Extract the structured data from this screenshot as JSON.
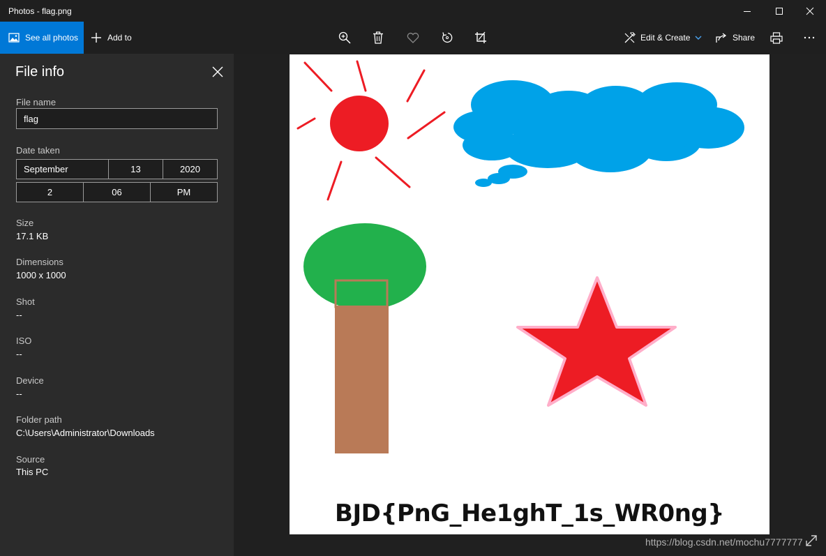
{
  "window": {
    "title": "Photos - flag.png"
  },
  "toolbar": {
    "see_all": "See all photos",
    "add_to": "Add to",
    "edit_create": "Edit & Create",
    "share": "Share"
  },
  "file_info": {
    "title": "File info",
    "file_name_label": "File name",
    "file_name": "flag",
    "date_taken_label": "Date taken",
    "month": "September",
    "day": "13",
    "year": "2020",
    "hour": "2",
    "minute": "06",
    "ampm": "PM",
    "size_label": "Size",
    "size": "17.1 KB",
    "dimensions_label": "Dimensions",
    "dimensions": "1000 x 1000",
    "shot_label": "Shot",
    "shot": "--",
    "iso_label": "ISO",
    "iso": "--",
    "device_label": "Device",
    "device": "--",
    "folder_label": "Folder path",
    "folder": "C:\\Users\\Administrator\\Downloads",
    "source_label": "Source",
    "source": "This PC"
  },
  "image": {
    "flag_text": "BJD{PnG_He1ghT_1s_WR0ng}",
    "colors": {
      "sun": "#ed1c24",
      "cloud": "#00a2e8",
      "tree_top": "#22b14c",
      "trunk": "#b97a57",
      "star": "#ed1c24",
      "star_border": "#ffaec9"
    }
  },
  "watermark": "https://blog.csdn.net/mochu7777777",
  "colors": {
    "accent": "#0078d7",
    "panel_bg": "#2b2b2b",
    "app_bg": "#1f1f1f"
  }
}
